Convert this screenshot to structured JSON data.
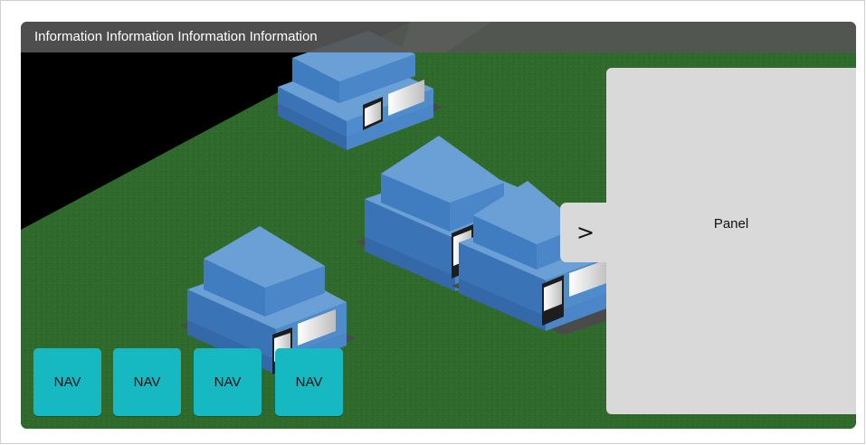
{
  "info_bar": {
    "text": "Information Information Information Information"
  },
  "panel": {
    "title": "Panel",
    "toggle_label": ">"
  },
  "nav": {
    "buttons": [
      {
        "label": "NAV"
      },
      {
        "label": "NAV"
      },
      {
        "label": "NAV"
      },
      {
        "label": "NAV"
      }
    ]
  },
  "colors": {
    "background": "#000000",
    "grass": "#2f6a2c",
    "building_top": "#6aa0d6",
    "building_side": "#3f7cc0",
    "info_bar": "#555555",
    "panel": "#d9d9d9",
    "nav_button": "#16b8c1"
  }
}
